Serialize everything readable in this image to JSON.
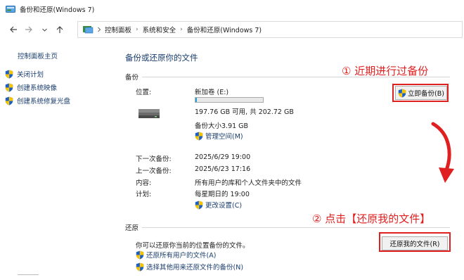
{
  "window": {
    "title": "备份和还原(Windows 7)"
  },
  "address_bar": {
    "breadcrumbs": [
      "控制面板",
      "系统和安全",
      "备份和还原(Windows 7)"
    ]
  },
  "sidebar": {
    "home_label": "控制面板主页",
    "items": [
      {
        "label": "关闭计划",
        "icon": "uac-shield-icon"
      },
      {
        "label": "创建系统映像",
        "icon": "uac-shield-icon"
      },
      {
        "label": "创建系统修复光盘",
        "icon": "uac-shield-icon"
      }
    ]
  },
  "main": {
    "title": "备份或还原你的文件",
    "backup": {
      "section_label": "备份",
      "location_label": "位置:",
      "drive_name": "新加卷 (E:)",
      "drive_usage_fraction": 0.02,
      "free_space": "197.76 GB 可用, 共 202.72 GB",
      "backup_size": "备份大小3.91 GB",
      "manage_space_link": "管理空间(M)",
      "backup_now_button": "立即备份(B)",
      "next_backup_label": "下一次备份:",
      "next_backup_value": "2025/6/29 19:00",
      "last_backup_label": "上一次备份:",
      "last_backup_value": "2025/6/23 17:16",
      "contents_label": "内容:",
      "contents_value": "所有用户的库和个人文件夹中的文件",
      "schedule_label": "计划:",
      "schedule_value": "每星期日的 19:00",
      "change_settings_link": "更改设置(C)"
    },
    "restore": {
      "section_label": "还原",
      "description": "你可以还原你当前的位置备份的文件。",
      "restore_my_files_button": "还原我的文件(R)",
      "restore_all_users_link": "还原所有用户的文件(A)",
      "select_other_backup_link": "选择其他用来还原文件的备份(N)"
    }
  },
  "annotations": {
    "note1": "① 近期进行过备份",
    "note2": "② 点击【还原我的文件】",
    "color": "#e02020"
  }
}
